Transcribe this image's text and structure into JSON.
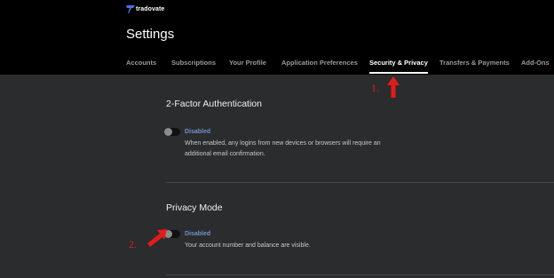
{
  "brand": {
    "name": "tradovate"
  },
  "page": {
    "title": "Settings"
  },
  "tabs": [
    {
      "label": "Accounts",
      "active": false
    },
    {
      "label": "Subscriptions",
      "active": false
    },
    {
      "label": "Your Profile",
      "active": false
    },
    {
      "label": "Application Preferences",
      "active": false
    },
    {
      "label": "Security & Privacy",
      "active": true
    },
    {
      "label": "Transfers & Payments",
      "active": false
    },
    {
      "label": "Add-Ons",
      "active": false
    }
  ],
  "sections": [
    {
      "title": "2-Factor Authentication",
      "toggle_on": false,
      "status": "Disabled",
      "description": "When enabled, any logins from new devices or browsers will require an additional email confirmation."
    },
    {
      "title": "Privacy Mode",
      "toggle_on": false,
      "status": "Disabled",
      "description": "Your account number and balance are visible."
    }
  ],
  "annotations": [
    {
      "label": "1."
    },
    {
      "label": "2."
    }
  ],
  "colors": {
    "background": "#2b2c2e",
    "header": "#000000",
    "status_link": "#6f93c9",
    "annotation": "#e31b1b"
  }
}
